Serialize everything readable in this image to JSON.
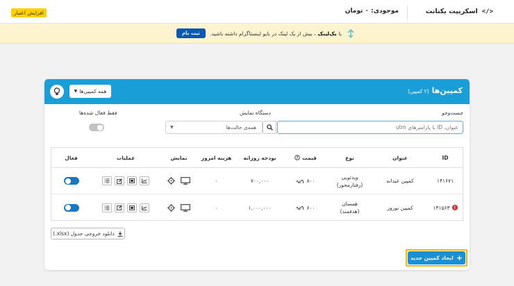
{
  "topbar": {
    "brand_label": "اسکریپت یکتانت",
    "brand_code": "</>",
    "balance_text": "موجودی: ۰ تومان",
    "credit_button": "افزایش اعتبار"
  },
  "banner": {
    "prefix": "با",
    "link_text": "یک‌لینک",
    "suffix": "، بیش از یک لینک در بایو اینستاگرام داشته باشید.",
    "register_button": "ثبت نام"
  },
  "card": {
    "title": "کمپین‌ها",
    "count_label": "(۲ کمپین)",
    "all_campaigns_button": "همه کمپین‌ها",
    "filters": {
      "search_label": "جست‌وجو",
      "search_placeholder": "عنوان، ID یا پارامترهای utm",
      "device_label": "دستگاه نمایش",
      "device_value": "همه‌ی حالت‌ها",
      "active_only_label": "فقط فعال شده‌ها"
    },
    "table": {
      "headers": {
        "id": "ID",
        "title": "عنوان",
        "type": "نوع",
        "price": "قیمت",
        "daily_budget": "بودجه روزانه",
        "today_cost": "هزینه امروز",
        "display": "نمایش",
        "operations": "عملیات",
        "active": "فعال"
      },
      "rows": [
        {
          "id": "۱۴۱۶۷۱",
          "title": "کمپین عیدانه",
          "type_line1": "ویدئویی",
          "type_line2": "(رفتارمحور)",
          "price": "۸۰۰",
          "daily_budget": "۷۰۰,۰۰۰",
          "today_cost": "۰",
          "active": true,
          "has_error": false
        },
        {
          "id": "۱۴۱۵۶۳",
          "title": "کمپین نوروز",
          "type_line1": "همسان",
          "type_line2": "(هدفمند)",
          "price": "۶۰۰",
          "daily_budget": "۱,۰۰۰,۰۰۰",
          "today_cost": "۰",
          "active": true,
          "has_error": true,
          "error_mark": "!"
        }
      ]
    },
    "download_button": "دانلود خروجی جدول (xlsx.)",
    "create_button": "ایجاد کمپین جدید"
  },
  "colors": {
    "primary": "#1a9ed8",
    "toggle_on": "#1a78c2",
    "highlight": "#f5b800",
    "credit": "#ffd000",
    "banner_bg": "#fdf3cf",
    "error": "#e02b2b"
  },
  "icons": {
    "currency": "toman-icon",
    "bulb": "bulb-icon",
    "search": "search-icon",
    "plus": "plus-icon",
    "download": "download-icon"
  }
}
